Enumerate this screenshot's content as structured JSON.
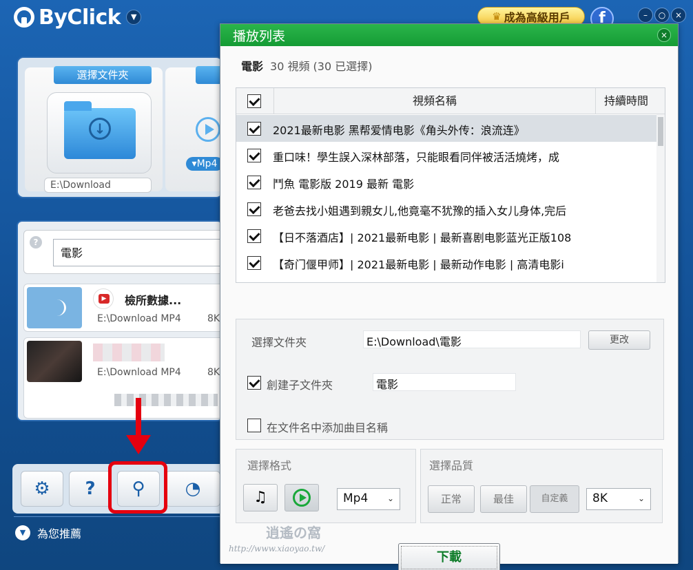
{
  "app": {
    "name": "ByClick",
    "premium_label": "成為高級用戶",
    "facebook_label": "f"
  },
  "main": {
    "choose_folder_label": "選擇文件夾",
    "folder_path": "E:\\Download",
    "format_pill": "▾Mp4",
    "search_text": "電影",
    "items": [
      {
        "title": "檢所數據...",
        "path": "E:\\Download",
        "format": "MP4",
        "size": "8K"
      },
      {
        "title": "",
        "path": "E:\\Download",
        "format": "MP4",
        "size": "8K"
      }
    ],
    "recommend_label": "為您推薦"
  },
  "dialog": {
    "title": "播放列表",
    "summary_name": "電影",
    "summary_count": "30 視頻 (30 已選擇)",
    "columns": {
      "name": "視頻名稱",
      "duration": "持續時間"
    },
    "rows": [
      {
        "title": "2021最新电影 黑帮爱情电影《角头外传：浪流连》",
        "checked": true
      },
      {
        "title": "重口味！學生誤入深林部落，只能眼看同伴被活活燒烤，成",
        "checked": true
      },
      {
        "title": "鬥魚 電影版 2019 最新 電影",
        "checked": true
      },
      {
        "title": "老爸去找小姐遇到親女儿,他竟毫不犹豫的插入女儿身体,完后",
        "checked": true
      },
      {
        "title": "【日不落酒店】| 2021最新电影 | 最新喜剧电影蓝光正版108",
        "checked": true
      },
      {
        "title": "【奇门偃甲师】| 2021最新电影 |  最新动作电影 | 高清电影i",
        "checked": true
      }
    ],
    "folder_label": "選擇文件夾",
    "folder_value": "E:\\Download\\電影",
    "change_button": "更改",
    "subfolder_label": "創建子文件夾",
    "subfolder_value": "電影",
    "add_title_label": "在文件名中添加曲目名稱",
    "format_section": "選擇格式",
    "format_value": "Mp4",
    "quality_section": "選擇品質",
    "quality_normal": "正常",
    "quality_best": "最佳",
    "quality_custom": "自定義",
    "quality_value": "8K",
    "download_button": "下載"
  },
  "watermark": {
    "site": "http://www.xiaoyao.tw/",
    "brand": "逍遙の窩"
  }
}
